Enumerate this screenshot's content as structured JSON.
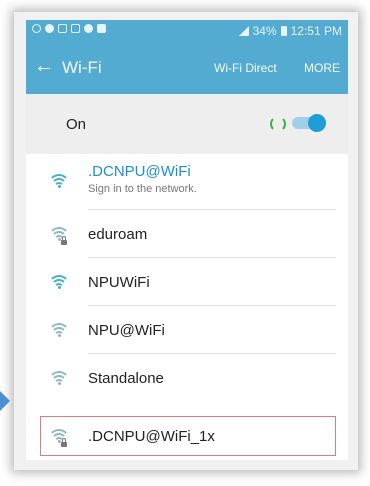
{
  "status_bar": {
    "battery": "34%",
    "time": "12:51 PM"
  },
  "app_bar": {
    "back_icon": "arrow-back-icon",
    "title": "Wi-Fi",
    "wifi_direct_label": "Wi-Fi Direct",
    "more_label": "MORE"
  },
  "wifi_toggle": {
    "label": "On",
    "state": "on",
    "accent_color": "#1e9ed9"
  },
  "networks": [
    {
      "name": ".DCNPU@WiFi",
      "subtitle": "Sign in to the network.",
      "secured": false,
      "connected": true
    },
    {
      "name": "eduroam",
      "secured": true
    },
    {
      "name": "NPUWiFi",
      "secured": false
    },
    {
      "name": "NPU@WiFi",
      "secured": false
    },
    {
      "name": "Standalone",
      "secured": false
    },
    {
      "name": ".DCNPU@WiFi_1x",
      "secured": true,
      "highlighted": true
    }
  ],
  "colors": {
    "header": "#54abd1",
    "connected_text": "#1d8fd0",
    "highlight_border": "#d88080"
  }
}
